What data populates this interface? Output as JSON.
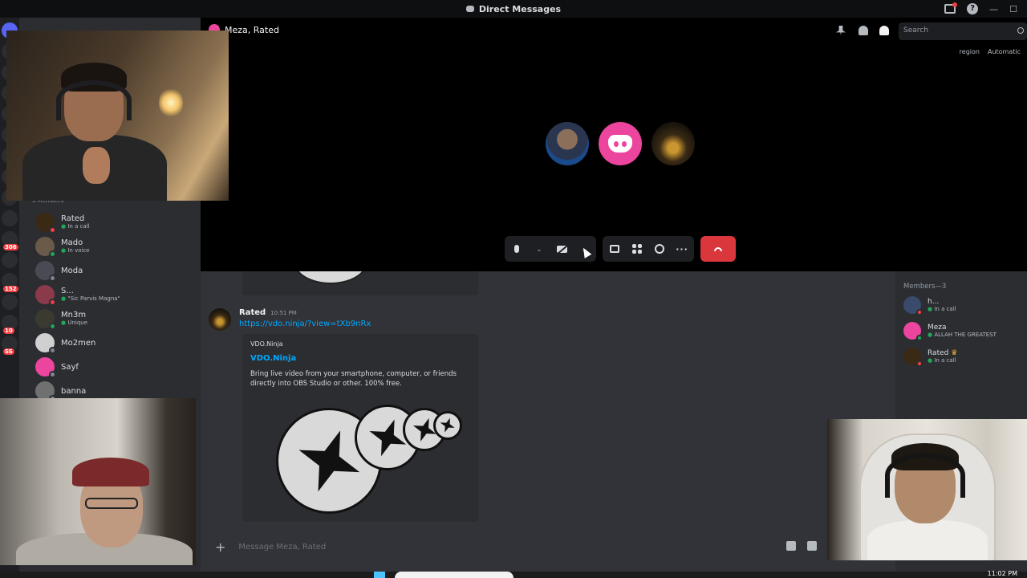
{
  "window": {
    "title": "Direct Messages"
  },
  "call": {
    "title": "Meza, Rated",
    "search_placeholder": "Search",
    "region_label": "region",
    "region_value": "Automatic",
    "participants": [
      "h...",
      "Meza",
      "Rated"
    ]
  },
  "sidebar": {
    "members_header": "3 Members",
    "dms": [
      {
        "name": "Rated",
        "status": "In a call",
        "status_type": "dnd"
      },
      {
        "name": "Mado",
        "status": "In voice",
        "status_type": "online"
      },
      {
        "name": "Moda",
        "status": "",
        "status_type": "offline"
      },
      {
        "name": "S...",
        "status": "\"Sic Parvis Magna\"",
        "status_type": "dnd"
      },
      {
        "name": "Mn3m",
        "status": "Unique",
        "status_type": "online"
      },
      {
        "name": "Mo2men",
        "status": "",
        "status_type": "offline"
      },
      {
        "name": "Sayf",
        "status": "",
        "status_type": "offline"
      },
      {
        "name": "banna",
        "status": "",
        "status_type": "offline"
      }
    ]
  },
  "rail": {
    "badges": [
      "306",
      "152",
      "10",
      "SS"
    ]
  },
  "chat": {
    "message": {
      "author": "Rated",
      "time": "10:51 PM",
      "link": "https://vdo.ninja/?view=tXb9nRx"
    },
    "embed": {
      "provider": "VDO.Ninja",
      "title": "VDO.Ninja",
      "description": "Bring live video from your smartphone, computer, or friends directly into OBS Studio or other. 100% free."
    },
    "composer_placeholder": "Message Meza, Rated"
  },
  "members": {
    "header": "Members—3",
    "list": [
      {
        "name": "h...",
        "status": "In a call"
      },
      {
        "name": "Meza",
        "status": "ALLAH THE GREATEST"
      },
      {
        "name": "Rated",
        "status": "In a call"
      }
    ]
  },
  "taskbar": {
    "time": "11:02 PM"
  },
  "colors": {
    "accent": "#5865f2",
    "danger": "#da373c",
    "online": "#23a559",
    "link": "#00a8fc",
    "pink": "#eb459e"
  }
}
